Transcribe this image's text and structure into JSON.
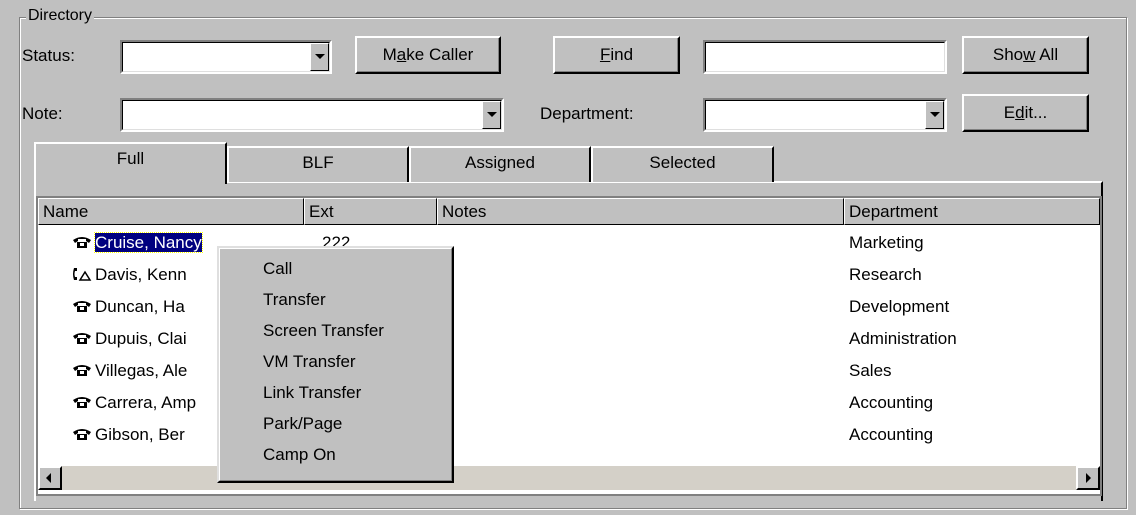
{
  "directory": {
    "group_title": "Directory",
    "status_label": "Status:",
    "status_value": "",
    "make_caller_button": {
      "pre": "M",
      "u": "a",
      "post": "ke Caller"
    },
    "find_button": {
      "pre": "",
      "u": "F",
      "post": "ind"
    },
    "find_value": "",
    "show_all_button": {
      "pre": "Sho",
      "u": "w",
      "post": " All"
    },
    "note_label": "Note:",
    "note_value": "",
    "department_label": "Department:",
    "department_value": "",
    "edit_button": {
      "pre": "E",
      "u": "d",
      "post": "it..."
    }
  },
  "tabs": [
    {
      "label": "Full",
      "active": true
    },
    {
      "label": "BLF",
      "active": false
    },
    {
      "label": "Assigned",
      "active": false
    },
    {
      "label": "Selected",
      "active": false
    }
  ],
  "columns": [
    "Name",
    "Ext",
    "Notes",
    "Department"
  ],
  "rows": [
    {
      "name": "Cruise, Nancy",
      "ext": "222",
      "notes": "",
      "department": "Marketing",
      "icon": "phone-icon",
      "selected": true
    },
    {
      "name": "Davis, Kenn",
      "ext": "",
      "notes": "",
      "department": "Research",
      "icon": "phone-offhook-icon"
    },
    {
      "name": "Duncan, Ha",
      "ext": "",
      "notes": "",
      "department": "Development",
      "icon": "phone-icon"
    },
    {
      "name": "Dupuis, Clai",
      "ext": "",
      "notes": "",
      "department": "Administration",
      "icon": "phone-icon"
    },
    {
      "name": "Villegas, Ale",
      "ext": "",
      "notes": "",
      "department": "Sales",
      "icon": "phone-icon"
    },
    {
      "name": "Carrera, Amp",
      "ext": "",
      "notes": "",
      "department": "Accounting",
      "icon": "phone-icon"
    },
    {
      "name": "Gibson, Ber",
      "ext": "",
      "notes": "",
      "department": "Accounting",
      "icon": "phone-icon"
    }
  ],
  "context_menu": [
    "Call",
    "Transfer",
    "Screen Transfer",
    "VM Transfer",
    "Link Transfer",
    "Park/Page",
    "Camp On"
  ]
}
